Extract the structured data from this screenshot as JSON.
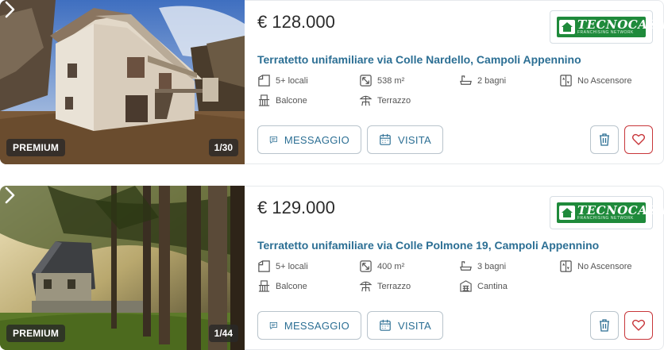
{
  "colors": {
    "accent": "#2c6f94",
    "favorite": "#c8363a",
    "brand": "#1f8a3b"
  },
  "listings": [
    {
      "price": "€ 128.000",
      "title": "Terratetto unifamiliare via Colle Nardello, Campoli Appennino",
      "badge": "PREMIUM",
      "photo_counter": "1/30",
      "agency": {
        "name": "TECNOCASA",
        "tagline": "FRANCHISING NETWORK"
      },
      "features": [
        {
          "icon": "rooms-icon",
          "text": "5+ locali"
        },
        {
          "icon": "area-icon",
          "text": "538 m²"
        },
        {
          "icon": "bath-icon",
          "text": "2 bagni"
        },
        {
          "icon": "elevator-icon",
          "text": "No Ascensore"
        },
        {
          "icon": "balcony-icon",
          "text": "Balcone"
        },
        {
          "icon": "terrace-icon",
          "text": "Terrazzo"
        }
      ],
      "buttons": {
        "message": "MESSAGGIO",
        "visit": "VISITA"
      }
    },
    {
      "price": "€ 129.000",
      "title": "Terratetto unifamiliare via Colle Polmone 19, Campoli Appennino",
      "badge": "PREMIUM",
      "photo_counter": "1/44",
      "agency": {
        "name": "TECNOCASA",
        "tagline": "FRANCHISING NETWORK"
      },
      "features": [
        {
          "icon": "rooms-icon",
          "text": "5+ locali"
        },
        {
          "icon": "area-icon",
          "text": "400 m²"
        },
        {
          "icon": "bath-icon",
          "text": "3 bagni"
        },
        {
          "icon": "elevator-icon",
          "text": "No Ascensore"
        },
        {
          "icon": "balcony-icon",
          "text": "Balcone"
        },
        {
          "icon": "terrace-icon",
          "text": "Terrazzo"
        },
        {
          "icon": "cellar-icon",
          "text": "Cantina"
        }
      ],
      "buttons": {
        "message": "MESSAGGIO",
        "visit": "VISITA"
      }
    }
  ]
}
